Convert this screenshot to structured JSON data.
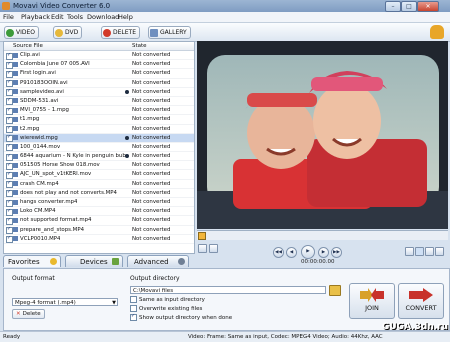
{
  "window": {
    "title": "Movavi Video Converter 6.0",
    "min": "–",
    "max": "□",
    "close": "✕"
  },
  "menu": [
    "File",
    "Playback",
    "Edit",
    "Tools",
    "Download",
    "Help"
  ],
  "toolbar": {
    "video": "VIDEO",
    "dvd": "DVD",
    "delete": "DELETE",
    "gallery": "GALLERY"
  },
  "filelist": {
    "col_source": "Source File",
    "col_state": "State",
    "rows": [
      {
        "name": "Clip.avi",
        "state": "Not converted"
      },
      {
        "name": "Colombia June 07 005.AVI",
        "state": "Not converted"
      },
      {
        "name": "First login.avi",
        "state": "Not converted"
      },
      {
        "name": "P910183OOIN.avi",
        "state": "Not converted"
      },
      {
        "name": "samplevideo.avi",
        "state": "Not converted"
      },
      {
        "name": "SDDM-531.avi",
        "state": "Not converted"
      },
      {
        "name": "MVI_0755 - 1.mpg",
        "state": "Not converted"
      },
      {
        "name": "t1.mpg",
        "state": "Not converted"
      },
      {
        "name": "t2.mpg",
        "state": "Not converted"
      },
      {
        "name": "wierewid.mpg",
        "state": "Not converted"
      },
      {
        "name": "100_0144.mov",
        "state": "Not converted"
      },
      {
        "name": "6844 aquarium - N Kyle in penguin bubble.MOV",
        "state": "Not converted"
      },
      {
        "name": "051505 Horse Show 018.mov",
        "state": "Not converted"
      },
      {
        "name": "AJC_UN_spot_v1tKERI.mov",
        "state": "Not converted"
      },
      {
        "name": "crash CM.mp4",
        "state": "Not converted"
      },
      {
        "name": "does not play and not converts.MP4",
        "state": "Not converted"
      },
      {
        "name": "hangs converter.mp4",
        "state": "Not converted"
      },
      {
        "name": "Loko CM.MP4",
        "state": "Not converted"
      },
      {
        "name": "not supported format.mp4",
        "state": "Not converted"
      },
      {
        "name": "prepare_and_stops.MP4",
        "state": "Not converted"
      },
      {
        "name": "VCLP0010.MP4",
        "state": "Not converted"
      }
    ]
  },
  "player": {
    "time": "00:00:00.00"
  },
  "tabs": {
    "favorites": "Favorites",
    "devices": "Devices",
    "advanced": "Advanced"
  },
  "output": {
    "format_label": "Output format",
    "format_value": "Mpeg-4 format (.mp4)",
    "delete": "Delete",
    "dir_label": "Output directory",
    "dir_value": "C:\\Movavi files",
    "same_as_input": "Same as input directory",
    "overwrite": "Overwrite existing files",
    "show_when_done": "Show output directory when done"
  },
  "buttons": {
    "join": "JOIN",
    "convert": "CONVERT"
  },
  "status": {
    "ready": "Ready",
    "info": "Video: Frame: Same as input, Codec: MPEG4 Video; Audio: 44Khz, AAC"
  },
  "watermark": "GUGA.3dn.ru"
}
